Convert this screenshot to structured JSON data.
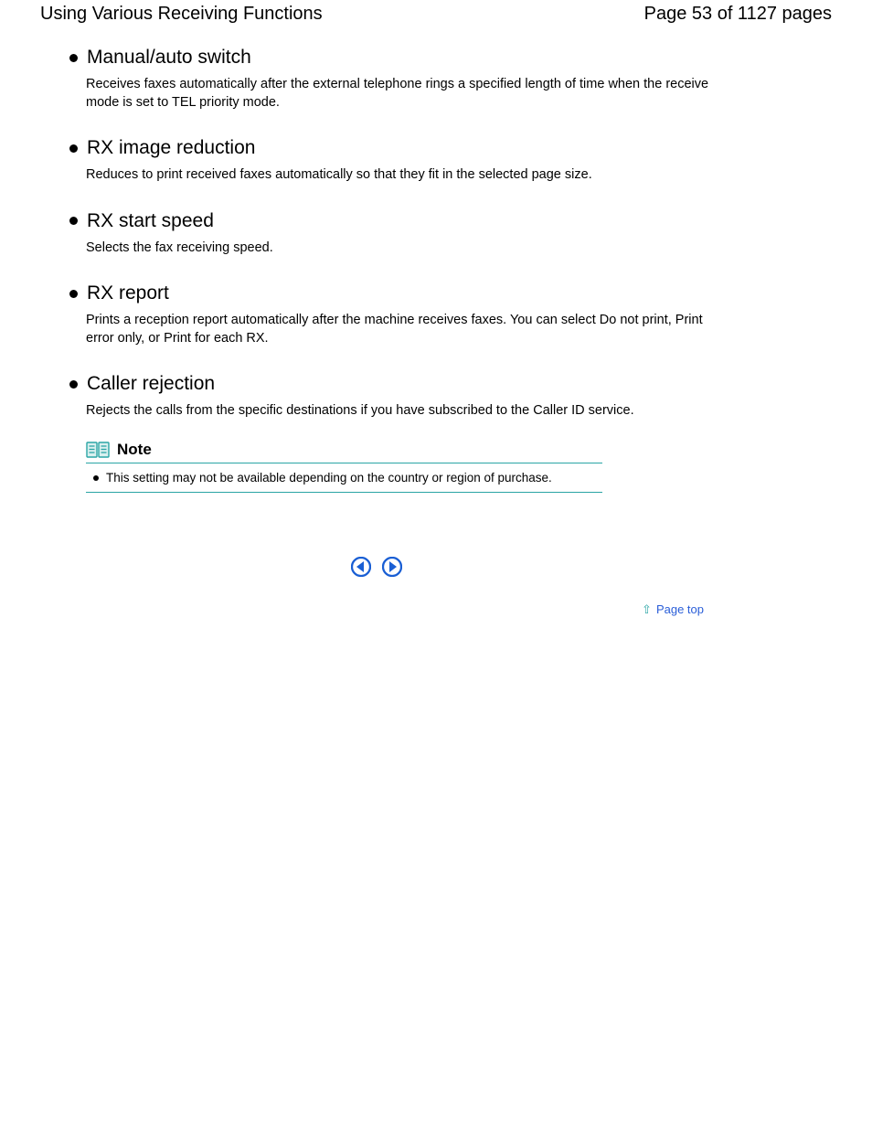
{
  "header": {
    "title": "Using Various Receiving Functions",
    "page_indicator": "Page 53 of 1127 pages"
  },
  "sections": [
    {
      "title": "Manual/auto switch",
      "body": "Receives faxes automatically after the external telephone rings a specified length of time when the receive mode is set to TEL priority mode."
    },
    {
      "title": "RX image reduction",
      "body": "Reduces to print received faxes automatically so that they fit in the selected page size."
    },
    {
      "title": "RX start speed",
      "body": "Selects the fax receiving speed."
    },
    {
      "title": "RX report",
      "body": "Prints a reception report automatically after the machine receives faxes. You can select Do not print, Print error only, or Print for each RX."
    },
    {
      "title": "Caller rejection",
      "body": "Rejects the calls from the specific destinations if you have subscribed to the Caller ID service."
    }
  ],
  "note": {
    "label": "Note",
    "text": "This setting may not be available depending on the country or region of purchase."
  },
  "footer": {
    "page_top": "Page top"
  }
}
